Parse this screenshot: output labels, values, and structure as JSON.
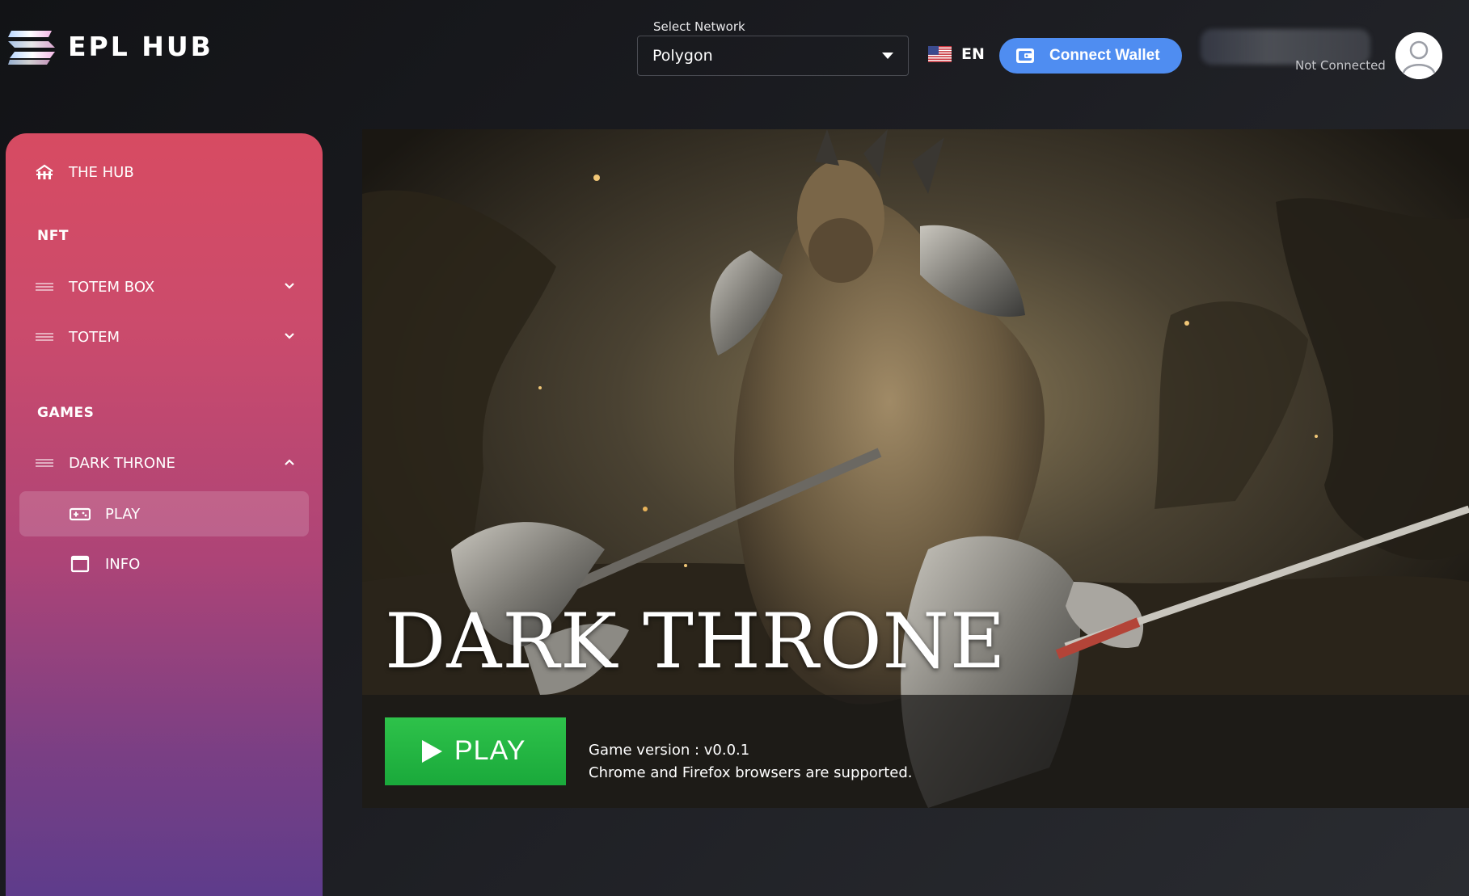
{
  "header": {
    "brand": "EPL HUB",
    "network": {
      "label": "Select Network",
      "value": "Polygon"
    },
    "language": {
      "code": "EN",
      "flag_icon": "us-flag-icon"
    },
    "connect_wallet_label": "Connect Wallet",
    "account_status": "Not Connected",
    "colors": {
      "connect_button": "#4f8df1"
    }
  },
  "sidebar": {
    "hub_label": "THE HUB",
    "sections": {
      "nft": "NFT",
      "games": "GAMES"
    },
    "nft_items": [
      {
        "label": "TOTEM BOX",
        "icon": "list-icon",
        "expanded": false
      },
      {
        "label": "TOTEM",
        "icon": "list-icon",
        "expanded": false
      }
    ],
    "game_items": [
      {
        "label": "DARK THRONE",
        "icon": "list-icon",
        "expanded": true
      }
    ],
    "sub_items": [
      {
        "label": "PLAY",
        "icon": "gamepad-icon",
        "active": true
      },
      {
        "label": "INFO",
        "icon": "window-icon",
        "active": false
      }
    ],
    "colors": {
      "top": "#d74b62",
      "bottom": "#5b3c8c"
    }
  },
  "game": {
    "title": "DARK THRONE",
    "play_label": "PLAY",
    "version_text": "Game version : v0.0.1",
    "support_text": "Chrome and Firefox browsers are supported.",
    "colors": {
      "play_button": "#1fb13f"
    }
  }
}
